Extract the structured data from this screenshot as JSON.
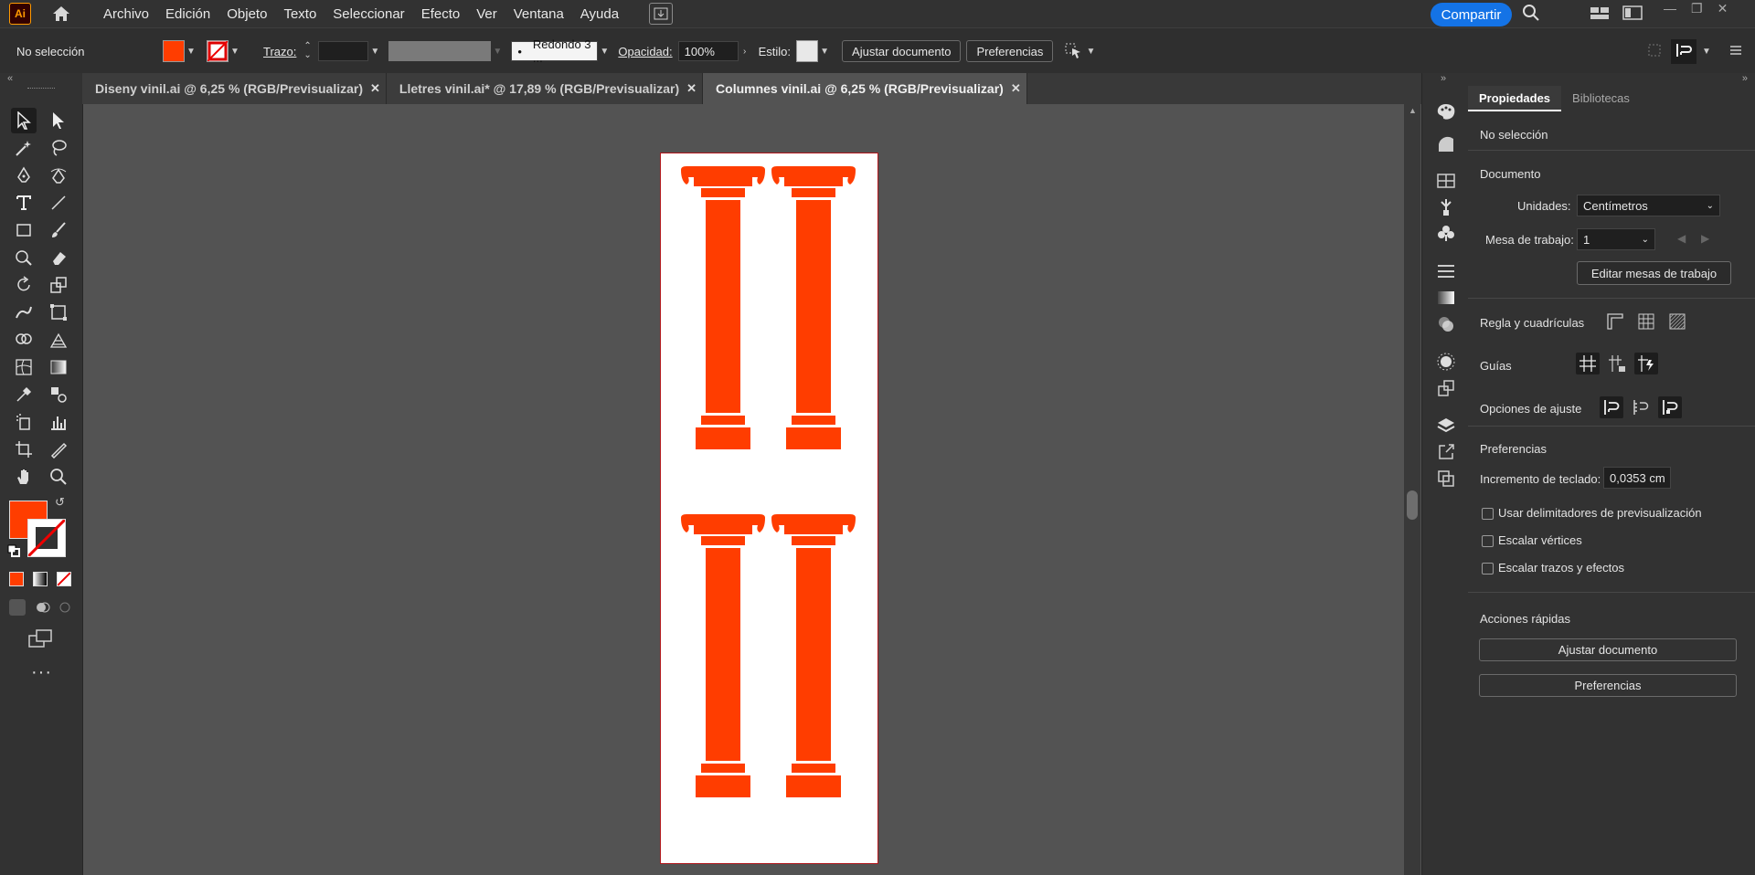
{
  "app": {
    "logo": "Ai"
  },
  "menu": [
    "Archivo",
    "Edición",
    "Objeto",
    "Texto",
    "Seleccionar",
    "Efecto",
    "Ver",
    "Ventana",
    "Ayuda"
  ],
  "share_label": "Compartir",
  "control_bar": {
    "selection": "No selección",
    "fill_color": "#ff3d00",
    "stroke_label": "Trazo:",
    "brush_value": "Redondo 3 ...",
    "opacity_label": "Opacidad:",
    "opacity_value": "100%",
    "style_label": "Estilo:",
    "fit_doc_button": "Ajustar documento",
    "prefs_button": "Preferencias"
  },
  "tabs": [
    {
      "label": "Diseny vinil.ai @ 6,25 % (RGB/Previsualizar)",
      "active": false
    },
    {
      "label": "Lletres vinil.ai* @ 17,89 % (RGB/Previsualizar)",
      "active": false
    },
    {
      "label": "Columnes vinil.ai @ 6,25 % (RGB/Previsualizar)",
      "active": true
    }
  ],
  "artwork": {
    "column_color": "#ff3d00",
    "artboard_border": "#b0161b"
  },
  "properties": {
    "tab_active": "Propiedades",
    "tab_other": "Bibliotecas",
    "selection": "No selección",
    "document_heading": "Documento",
    "units_label": "Unidades:",
    "units_value": "Centímetros",
    "artboard_label": "Mesa de trabajo:",
    "artboard_value": "1",
    "edit_artboards_button": "Editar mesas de trabajo",
    "rulers_label": "Regla y cuadrículas",
    "guides_label": "Guías",
    "snap_label": "Opciones de ajuste",
    "prefs_heading": "Preferencias",
    "keyboard_label": "Incremento de teclado:",
    "keyboard_value": "0,0353 cm",
    "check_preview": "Usar delimitadores de previsualización",
    "check_corners": "Escalar vértices",
    "check_strokes": "Escalar trazos y efectos",
    "quick_actions": "Acciones rápidas",
    "quick_fit": "Ajustar documento",
    "quick_prefs": "Preferencias"
  }
}
